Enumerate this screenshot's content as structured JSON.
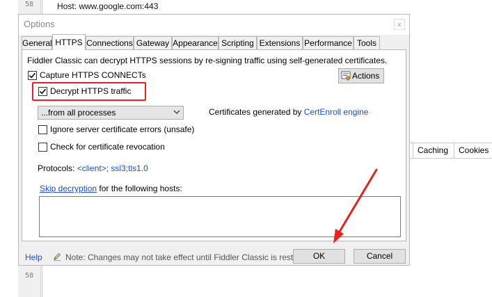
{
  "background": {
    "line_numbers": [
      "58",
      "58"
    ],
    "host_text": "Host: www.google.com:443",
    "tabs": [
      "Caching",
      "Cookies"
    ]
  },
  "dialog": {
    "title": "Options",
    "close_glyph": "x",
    "tabs": [
      {
        "label": "General",
        "active": false
      },
      {
        "label": "HTTPS",
        "active": true
      },
      {
        "label": "Connections",
        "active": false
      },
      {
        "label": "Gateway",
        "active": false
      },
      {
        "label": "Appearance",
        "active": false
      },
      {
        "label": "Scripting",
        "active": false
      },
      {
        "label": "Extensions",
        "active": false
      },
      {
        "label": "Performance",
        "active": false
      },
      {
        "label": "Tools",
        "active": false
      }
    ],
    "https": {
      "description": "Fiddler Classic can decrypt HTTPS sessions by re-signing traffic using self-generated certificates.",
      "capture_label": "Capture HTTPS CONNECTs",
      "capture_checked": true,
      "actions_label": "Actions",
      "decrypt_label": "Decrypt HTTPS traffic",
      "decrypt_checked": true,
      "process_filter": "...from all processes",
      "cert_prefix": "Certificates generated by ",
      "cert_engine": "CertEnroll engine",
      "ignore_errors_label": "Ignore server certificate errors (unsafe)",
      "ignore_errors_checked": false,
      "revocation_label": "Check for certificate revocation",
      "revocation_checked": false,
      "protocols_label": "Protocols: ",
      "protocols_value": "<client>; ssl3;tls1.0",
      "skip_link": "Skip decryption",
      "skip_suffix": " for the following hosts:",
      "skip_hosts": ""
    },
    "footer": {
      "help": "Help",
      "note": "Note: Changes may not take effect until Fiddler Classic is restarted.",
      "ok": "OK",
      "cancel": "Cancel"
    }
  },
  "colors": {
    "highlight": "#e8231f",
    "link": "#1a4fd1"
  }
}
